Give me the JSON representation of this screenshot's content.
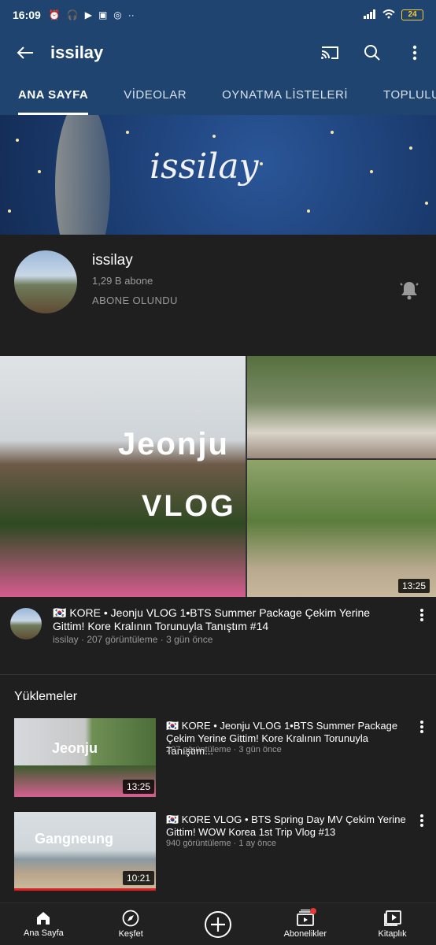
{
  "status_bar": {
    "time": "16:09",
    "battery": "24"
  },
  "app_bar": {
    "title": "issilay"
  },
  "tabs": [
    {
      "label": "ANA SAYFA"
    },
    {
      "label": "VİDEOLAR"
    },
    {
      "label": "OYNATMA LİSTELERİ"
    },
    {
      "label": "TOPLULUK"
    }
  ],
  "banner": {
    "logo_text": "issilay"
  },
  "channel": {
    "name": "issilay",
    "subscribers": "1,29 B abone",
    "subscribe_state": "ABONE OLUNDU"
  },
  "featured": {
    "thumb_title": "Jeonju",
    "thumb_subtitle": "VLOG",
    "duration": "13:25",
    "title": "🇰🇷 KORE • Jeonju VLOG 1•BTS Summer Package Çekim Yerine Gittim! Kore Kralının Torunuyla Tanıştım #14",
    "meta": "issilay · 207 görüntüleme · 3 gün önce"
  },
  "uploads": {
    "section_title": "Yüklemeler",
    "items": [
      {
        "title": "🇰🇷 KORE • Jeonju VLOG 1•BTS Summer Package Çekim Yerine Gittim! Kore Kralının Torunuyla Tanıştım...",
        "meta": "207 görüntüleme · 3 gün önce",
        "duration": "13:25",
        "thumb_text": "Jeonju"
      },
      {
        "title": "🇰🇷 KORE VLOG • BTS Spring Day MV Çekim Yerine Gittim! WOW Korea 1st Trip Vlog #13",
        "meta": "940 görüntüleme · 1 ay önce",
        "duration": "10:21",
        "thumb_text": "Gangneung"
      }
    ]
  },
  "bottom_nav": [
    {
      "label": "Ana Sayfa",
      "icon": "home-icon"
    },
    {
      "label": "Keşfet",
      "icon": "explore-icon"
    },
    {
      "label": "",
      "icon": "create-icon"
    },
    {
      "label": "Abonelikler",
      "icon": "subscriptions-icon"
    },
    {
      "label": "Kitaplık",
      "icon": "library-icon"
    }
  ],
  "colors": {
    "header_bg": "#1f446f",
    "page_bg": "#1f1f1f",
    "notification_dot": "#e53935"
  }
}
